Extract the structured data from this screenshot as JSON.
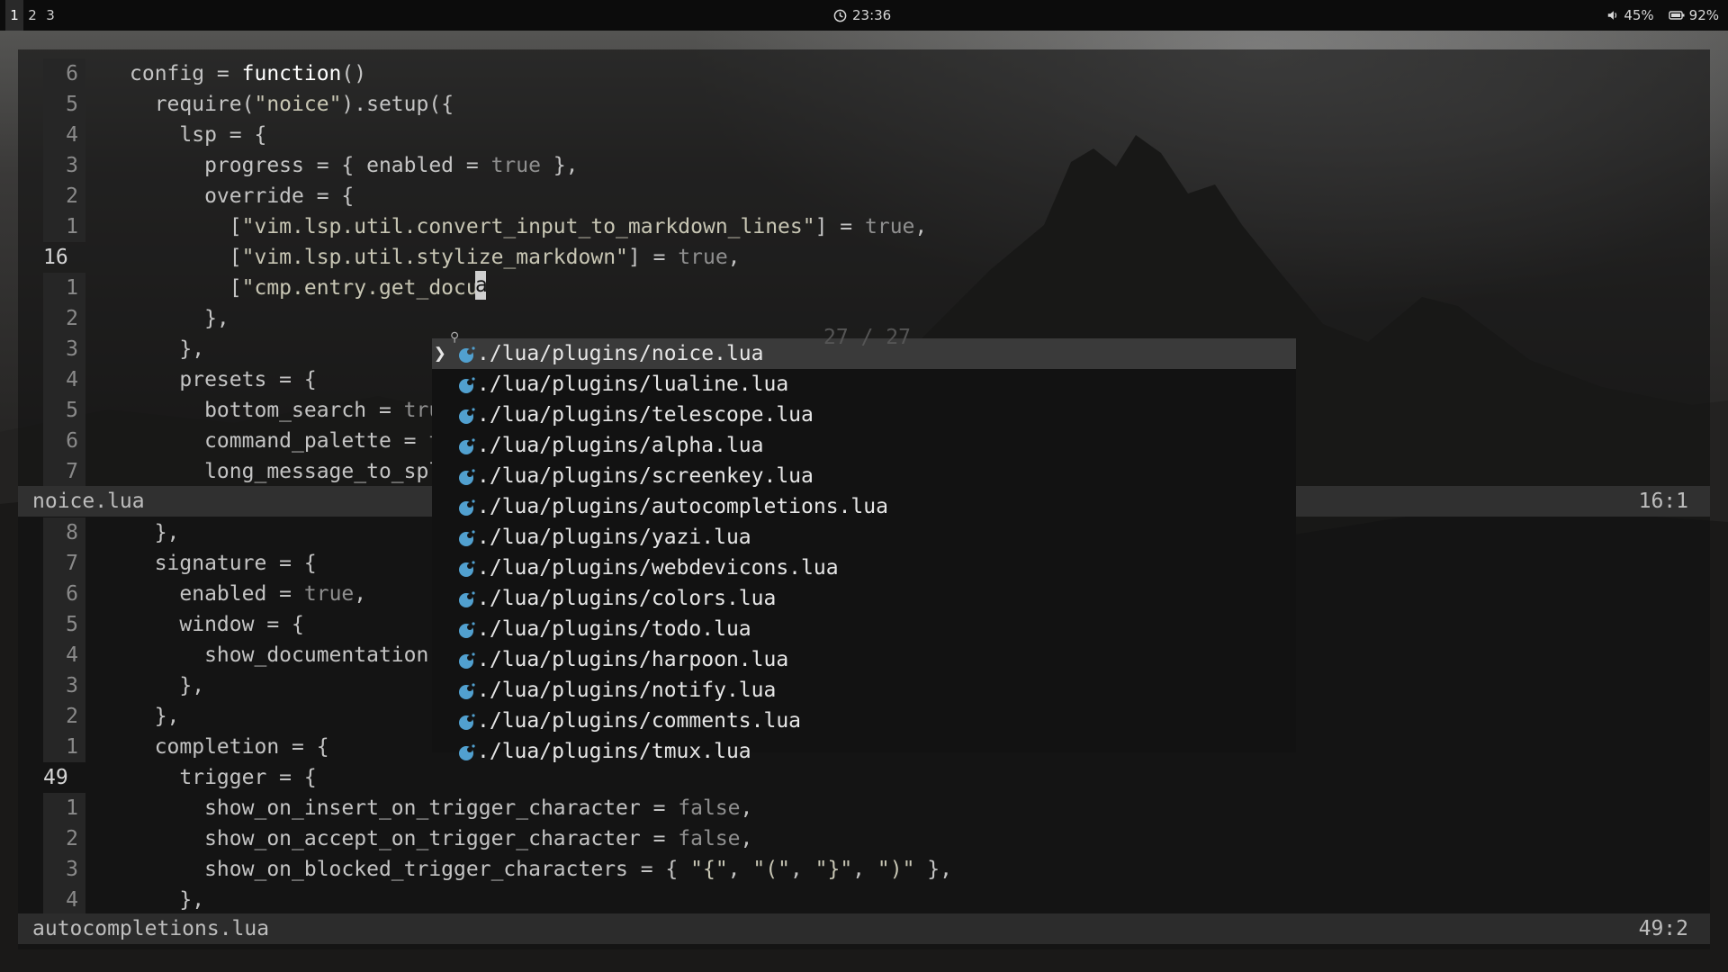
{
  "topbar": {
    "workspaces": [
      "1",
      "2",
      "3"
    ],
    "clock": "23:36",
    "volume": "45%",
    "battery": "92%"
  },
  "editor": {
    "top_pane": {
      "lines": [
        {
          "num": "6",
          "current": false,
          "text": "config = function()"
        },
        {
          "num": "5",
          "current": false,
          "text": "  require(\"noice\").setup({"
        },
        {
          "num": "4",
          "current": false,
          "text": "    lsp = {"
        },
        {
          "num": "3",
          "current": false,
          "text": "      progress = { enabled = true },"
        },
        {
          "num": "2",
          "current": false,
          "text": "      override = {"
        },
        {
          "num": "1",
          "current": false,
          "text": "        [\"vim.lsp.util.convert_input_to_markdown_lines\"] = true,"
        },
        {
          "num": "16",
          "current": true,
          "text": "        [\"vim.lsp.util.stylize_markdown\"] = true,"
        },
        {
          "num": "1",
          "current": false,
          "text": "        [\"cmp.entry.get_docu"
        },
        {
          "num": "2",
          "current": false,
          "text": "      },"
        },
        {
          "num": "3",
          "current": false,
          "text": "    },"
        },
        {
          "num": "4",
          "current": false,
          "text": "    presets = {"
        },
        {
          "num": "5",
          "current": false,
          "text": "      bottom_search = true,"
        },
        {
          "num": "6",
          "current": false,
          "text": "      command_palette = true,"
        },
        {
          "num": "7",
          "current": false,
          "text": "      long_message_to_split"
        }
      ],
      "filename": "noice.lua",
      "position": "16:1"
    },
    "bottom_pane": {
      "lines": [
        {
          "num": "8",
          "current": false,
          "text": "  },"
        },
        {
          "num": "7",
          "current": false,
          "text": "  signature = {"
        },
        {
          "num": "6",
          "current": false,
          "text": "    enabled = true,"
        },
        {
          "num": "5",
          "current": false,
          "text": "    window = {"
        },
        {
          "num": "4",
          "current": false,
          "text": "      show_documentation = fa"
        },
        {
          "num": "3",
          "current": false,
          "text": "    },"
        },
        {
          "num": "2",
          "current": false,
          "text": "  },"
        },
        {
          "num": "1",
          "current": false,
          "text": "  completion = {"
        },
        {
          "num": "49",
          "current": true,
          "text": "    trigger = {"
        },
        {
          "num": "1",
          "current": false,
          "text": "      show_on_insert_on_trigger_character = false,"
        },
        {
          "num": "2",
          "current": false,
          "text": "      show_on_accept_on_trigger_character = false,"
        },
        {
          "num": "3",
          "current": false,
          "text": "      show_on_blocked_trigger_characters = { \"{\", \"(\", \"}\", \")\" },"
        },
        {
          "num": "4",
          "current": false,
          "text": "    },"
        }
      ],
      "filename": "autocompletions.lua",
      "position": "49:2"
    }
  },
  "picker": {
    "query": "a",
    "count": "27 / 27",
    "items": [
      {
        "label": "./lua/plugins/noice.lua",
        "selected": true
      },
      {
        "label": "./lua/plugins/lualine.lua",
        "selected": false
      },
      {
        "label": "./lua/plugins/telescope.lua",
        "selected": false
      },
      {
        "label": "./lua/plugins/alpha.lua",
        "selected": false
      },
      {
        "label": "./lua/plugins/screenkey.lua",
        "selected": false
      },
      {
        "label": "./lua/plugins/autocompletions.lua",
        "selected": false
      },
      {
        "label": "./lua/plugins/yazi.lua",
        "selected": false
      },
      {
        "label": "./lua/plugins/webdevicons.lua",
        "selected": false
      },
      {
        "label": "./lua/plugins/colors.lua",
        "selected": false
      },
      {
        "label": "./lua/plugins/todo.lua",
        "selected": false
      },
      {
        "label": "./lua/plugins/harpoon.lua",
        "selected": false
      },
      {
        "label": "./lua/plugins/notify.lua",
        "selected": false
      },
      {
        "label": "./lua/plugins/comments.lua",
        "selected": false
      },
      {
        "label": "./lua/plugins/tmux.lua",
        "selected": false
      }
    ],
    "icon_color": "#51a0cf",
    "selected_bg": "#3a3a3a"
  }
}
